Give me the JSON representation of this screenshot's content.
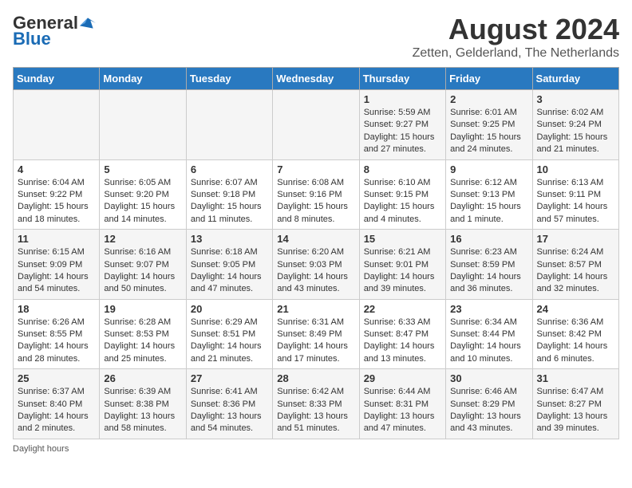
{
  "header": {
    "logo_general": "General",
    "logo_blue": "Blue",
    "month": "August 2024",
    "location": "Zetten, Gelderland, The Netherlands"
  },
  "weekdays": [
    "Sunday",
    "Monday",
    "Tuesday",
    "Wednesday",
    "Thursday",
    "Friday",
    "Saturday"
  ],
  "weeks": [
    [
      {
        "day": "",
        "info": ""
      },
      {
        "day": "",
        "info": ""
      },
      {
        "day": "",
        "info": ""
      },
      {
        "day": "",
        "info": ""
      },
      {
        "day": "1",
        "info": "Sunrise: 5:59 AM\nSunset: 9:27 PM\nDaylight: 15 hours and 27 minutes."
      },
      {
        "day": "2",
        "info": "Sunrise: 6:01 AM\nSunset: 9:25 PM\nDaylight: 15 hours and 24 minutes."
      },
      {
        "day": "3",
        "info": "Sunrise: 6:02 AM\nSunset: 9:24 PM\nDaylight: 15 hours and 21 minutes."
      }
    ],
    [
      {
        "day": "4",
        "info": "Sunrise: 6:04 AM\nSunset: 9:22 PM\nDaylight: 15 hours and 18 minutes."
      },
      {
        "day": "5",
        "info": "Sunrise: 6:05 AM\nSunset: 9:20 PM\nDaylight: 15 hours and 14 minutes."
      },
      {
        "day": "6",
        "info": "Sunrise: 6:07 AM\nSunset: 9:18 PM\nDaylight: 15 hours and 11 minutes."
      },
      {
        "day": "7",
        "info": "Sunrise: 6:08 AM\nSunset: 9:16 PM\nDaylight: 15 hours and 8 minutes."
      },
      {
        "day": "8",
        "info": "Sunrise: 6:10 AM\nSunset: 9:15 PM\nDaylight: 15 hours and 4 minutes."
      },
      {
        "day": "9",
        "info": "Sunrise: 6:12 AM\nSunset: 9:13 PM\nDaylight: 15 hours and 1 minute."
      },
      {
        "day": "10",
        "info": "Sunrise: 6:13 AM\nSunset: 9:11 PM\nDaylight: 14 hours and 57 minutes."
      }
    ],
    [
      {
        "day": "11",
        "info": "Sunrise: 6:15 AM\nSunset: 9:09 PM\nDaylight: 14 hours and 54 minutes."
      },
      {
        "day": "12",
        "info": "Sunrise: 6:16 AM\nSunset: 9:07 PM\nDaylight: 14 hours and 50 minutes."
      },
      {
        "day": "13",
        "info": "Sunrise: 6:18 AM\nSunset: 9:05 PM\nDaylight: 14 hours and 47 minutes."
      },
      {
        "day": "14",
        "info": "Sunrise: 6:20 AM\nSunset: 9:03 PM\nDaylight: 14 hours and 43 minutes."
      },
      {
        "day": "15",
        "info": "Sunrise: 6:21 AM\nSunset: 9:01 PM\nDaylight: 14 hours and 39 minutes."
      },
      {
        "day": "16",
        "info": "Sunrise: 6:23 AM\nSunset: 8:59 PM\nDaylight: 14 hours and 36 minutes."
      },
      {
        "day": "17",
        "info": "Sunrise: 6:24 AM\nSunset: 8:57 PM\nDaylight: 14 hours and 32 minutes."
      }
    ],
    [
      {
        "day": "18",
        "info": "Sunrise: 6:26 AM\nSunset: 8:55 PM\nDaylight: 14 hours and 28 minutes."
      },
      {
        "day": "19",
        "info": "Sunrise: 6:28 AM\nSunset: 8:53 PM\nDaylight: 14 hours and 25 minutes."
      },
      {
        "day": "20",
        "info": "Sunrise: 6:29 AM\nSunset: 8:51 PM\nDaylight: 14 hours and 21 minutes."
      },
      {
        "day": "21",
        "info": "Sunrise: 6:31 AM\nSunset: 8:49 PM\nDaylight: 14 hours and 17 minutes."
      },
      {
        "day": "22",
        "info": "Sunrise: 6:33 AM\nSunset: 8:47 PM\nDaylight: 14 hours and 13 minutes."
      },
      {
        "day": "23",
        "info": "Sunrise: 6:34 AM\nSunset: 8:44 PM\nDaylight: 14 hours and 10 minutes."
      },
      {
        "day": "24",
        "info": "Sunrise: 6:36 AM\nSunset: 8:42 PM\nDaylight: 14 hours and 6 minutes."
      }
    ],
    [
      {
        "day": "25",
        "info": "Sunrise: 6:37 AM\nSunset: 8:40 PM\nDaylight: 14 hours and 2 minutes."
      },
      {
        "day": "26",
        "info": "Sunrise: 6:39 AM\nSunset: 8:38 PM\nDaylight: 13 hours and 58 minutes."
      },
      {
        "day": "27",
        "info": "Sunrise: 6:41 AM\nSunset: 8:36 PM\nDaylight: 13 hours and 54 minutes."
      },
      {
        "day": "28",
        "info": "Sunrise: 6:42 AM\nSunset: 8:33 PM\nDaylight: 13 hours and 51 minutes."
      },
      {
        "day": "29",
        "info": "Sunrise: 6:44 AM\nSunset: 8:31 PM\nDaylight: 13 hours and 47 minutes."
      },
      {
        "day": "30",
        "info": "Sunrise: 6:46 AM\nSunset: 8:29 PM\nDaylight: 13 hours and 43 minutes."
      },
      {
        "day": "31",
        "info": "Sunrise: 6:47 AM\nSunset: 8:27 PM\nDaylight: 13 hours and 39 minutes."
      }
    ]
  ],
  "footer": "Daylight hours"
}
